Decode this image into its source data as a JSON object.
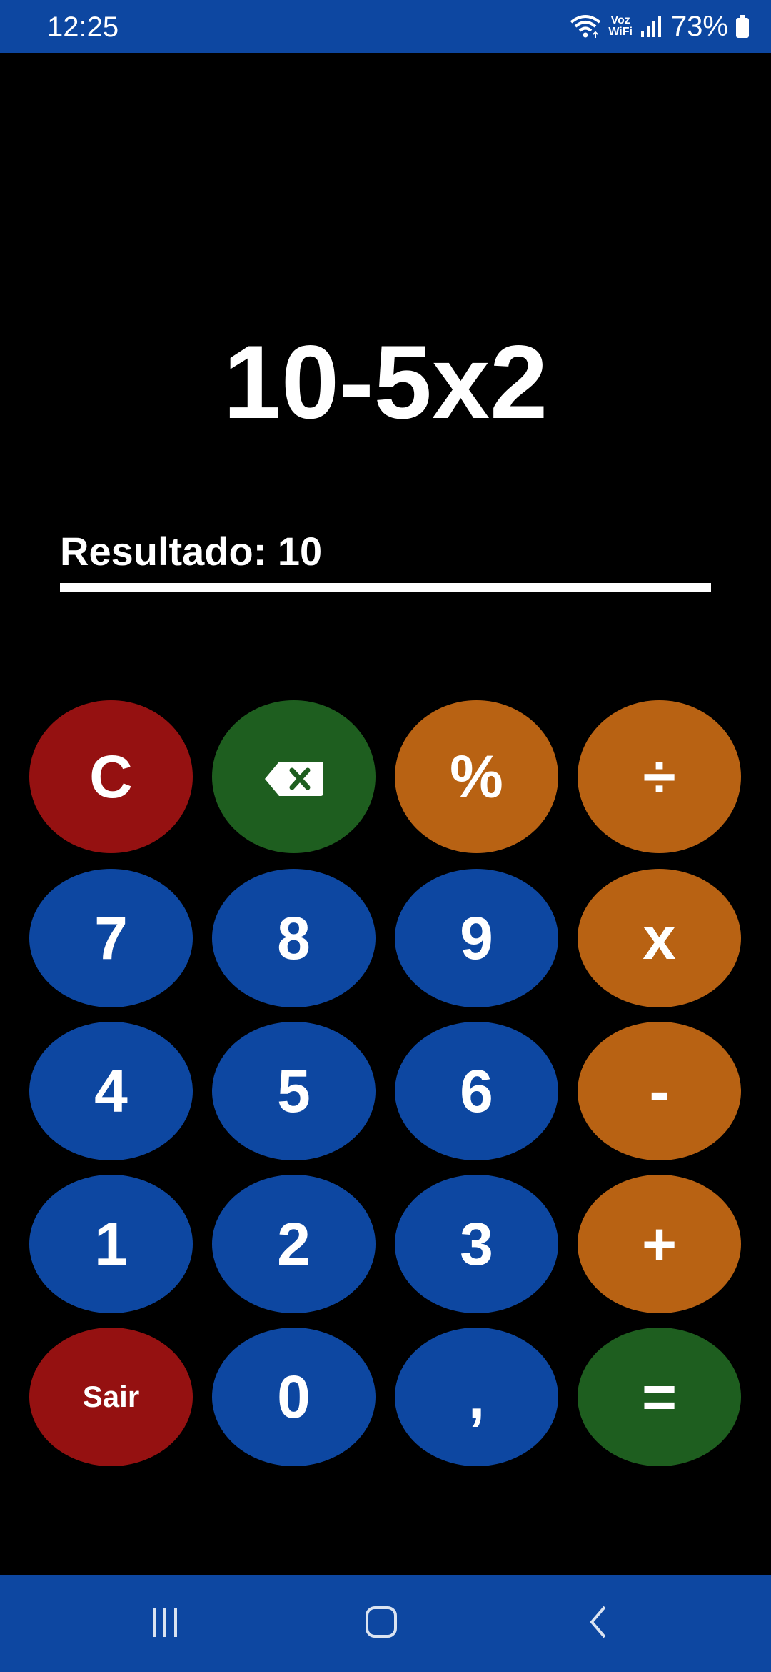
{
  "status_bar": {
    "time": "12:25",
    "voz_label_top": "Voz",
    "voz_label_bottom": "WiFi",
    "battery_percent": "73%",
    "background_color": "#0d47a1"
  },
  "display": {
    "expression": "10-5x2",
    "result_text": "Resultado: 10"
  },
  "keypad": {
    "rows": [
      [
        {
          "label": "C",
          "color": "red",
          "name": "clear-button"
        },
        {
          "label": "",
          "color": "green",
          "name": "backspace-button",
          "icon": "backspace-icon"
        },
        {
          "label": "%",
          "color": "orange",
          "name": "percent-button"
        },
        {
          "label": "÷",
          "color": "orange",
          "name": "divide-button"
        }
      ],
      [
        {
          "label": "7",
          "color": "blue",
          "name": "digit-7-button"
        },
        {
          "label": "8",
          "color": "blue",
          "name": "digit-8-button"
        },
        {
          "label": "9",
          "color": "blue",
          "name": "digit-9-button"
        },
        {
          "label": "x",
          "color": "orange",
          "name": "multiply-button"
        }
      ],
      [
        {
          "label": "4",
          "color": "blue",
          "name": "digit-4-button"
        },
        {
          "label": "5",
          "color": "blue",
          "name": "digit-5-button"
        },
        {
          "label": "6",
          "color": "blue",
          "name": "digit-6-button"
        },
        {
          "label": "-",
          "color": "orange",
          "name": "subtract-button"
        }
      ],
      [
        {
          "label": "1",
          "color": "blue",
          "name": "digit-1-button"
        },
        {
          "label": "2",
          "color": "blue",
          "name": "digit-2-button"
        },
        {
          "label": "3",
          "color": "blue",
          "name": "digit-3-button"
        },
        {
          "label": "+",
          "color": "orange",
          "name": "add-button"
        }
      ],
      [
        {
          "label": "Sair",
          "color": "red",
          "name": "exit-button",
          "small": true
        },
        {
          "label": "0",
          "color": "blue",
          "name": "digit-0-button"
        },
        {
          "label": ",",
          "color": "blue",
          "name": "decimal-button"
        },
        {
          "label": "=",
          "color": "green",
          "name": "equals-button"
        }
      ]
    ],
    "colors": {
      "red": "#951111",
      "green": "#1e5e1f",
      "orange": "#b86213",
      "blue": "#0d47a1"
    }
  },
  "nav_bar": {
    "buttons": [
      {
        "name": "recent-apps-button",
        "icon": "recent-apps-icon"
      },
      {
        "name": "home-button",
        "icon": "home-icon"
      },
      {
        "name": "back-button",
        "icon": "back-icon"
      }
    ]
  }
}
